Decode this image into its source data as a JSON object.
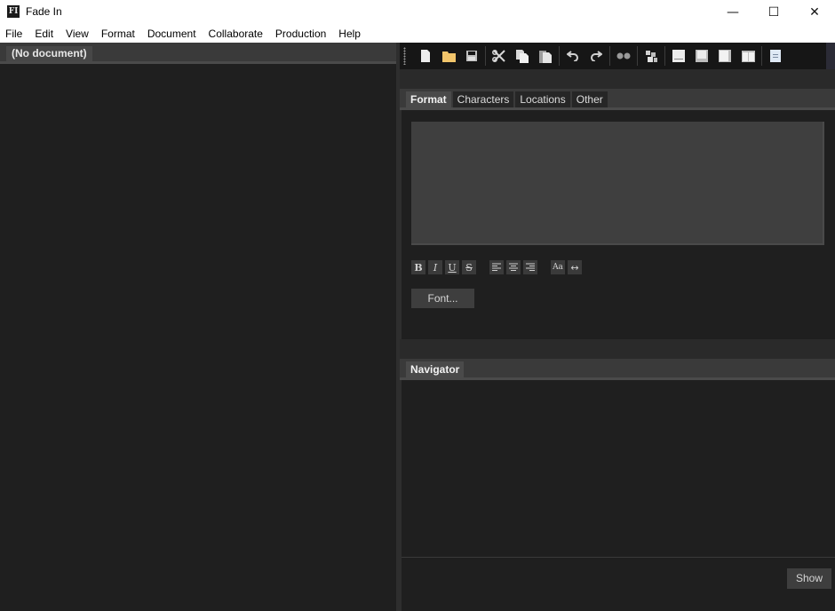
{
  "window": {
    "app_logo": "FI",
    "title": "Fade In",
    "controls": {
      "minimize_icon": "minimize-icon",
      "maximize_icon": "maximize-icon",
      "close_icon": "close-icon",
      "minimize_glyph": "—",
      "maximize_glyph": "☐",
      "close_glyph": "✕"
    }
  },
  "menubar": {
    "items": [
      "File",
      "Edit",
      "View",
      "Format",
      "Document",
      "Collaborate",
      "Production",
      "Help"
    ]
  },
  "left_pane": {
    "document_tab": "(No document)"
  },
  "toolbar": {
    "buttons": [
      {
        "name": "new-document",
        "icon": "new-document-icon"
      },
      {
        "name": "open-folder",
        "icon": "folder-icon"
      },
      {
        "name": "save",
        "icon": "save-icon"
      },
      {
        "name": "cut",
        "icon": "scissors-icon"
      },
      {
        "name": "copy",
        "icon": "copy-icon"
      },
      {
        "name": "paste",
        "icon": "paste-icon"
      },
      {
        "name": "undo",
        "icon": "undo-icon"
      },
      {
        "name": "redo",
        "icon": "redo-icon"
      },
      {
        "name": "find",
        "icon": "binoculars-icon"
      },
      {
        "name": "spelling",
        "icon": "spell-check-icon"
      },
      {
        "name": "layout-1",
        "icon": "page-layout-icon"
      },
      {
        "name": "layout-2",
        "icon": "page-layout-icon"
      },
      {
        "name": "layout-3",
        "icon": "page-layout-icon"
      },
      {
        "name": "layout-split",
        "icon": "split-view-icon"
      },
      {
        "name": "index-card",
        "icon": "index-card-icon"
      }
    ],
    "colors": {
      "folder": "#f2c56b",
      "page": "#e8e8e8",
      "muted": "#bdbdbd"
    }
  },
  "format_panel": {
    "tabs": [
      {
        "label": "Format",
        "active": true
      },
      {
        "label": "Characters",
        "active": false
      },
      {
        "label": "Locations",
        "active": false
      },
      {
        "label": "Other",
        "active": false
      }
    ],
    "formatting_buttons": [
      {
        "name": "bold",
        "glyph": "B"
      },
      {
        "name": "italic",
        "glyph": "I"
      },
      {
        "name": "underline",
        "glyph": "U"
      },
      {
        "name": "strikethrough",
        "glyph": "S"
      }
    ],
    "alignment_buttons": [
      {
        "name": "align-left",
        "glyph": "≡"
      },
      {
        "name": "align-center",
        "glyph": "≡"
      },
      {
        "name": "align-right",
        "glyph": "≡"
      }
    ],
    "case_button": "Aa",
    "width_button": "↔",
    "font_button": "Font..."
  },
  "navigator": {
    "title": "Navigator",
    "show_button": "Show"
  }
}
